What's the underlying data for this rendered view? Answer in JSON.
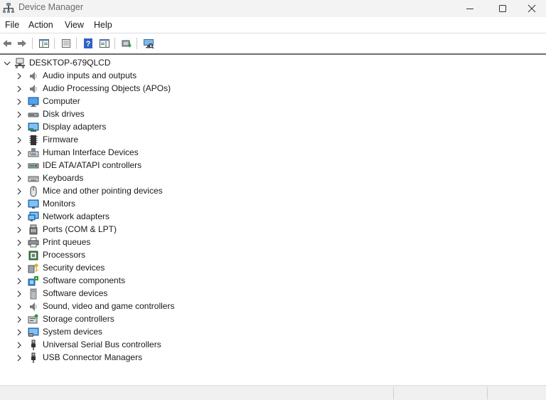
{
  "window": {
    "title": "Device Manager"
  },
  "menu": [
    "File",
    "Action",
    "View",
    "Help"
  ],
  "toolbar": {
    "buttons": [
      "back-icon",
      "forward-icon",
      "show-hide-console-tree-icon",
      "properties-icon",
      "help-icon",
      "action-pane-icon",
      "update-driver-icon",
      "scan-hardware-icon"
    ]
  },
  "tree": {
    "root": "DESKTOP-679QLCD",
    "items": [
      {
        "label": "Audio inputs and outputs",
        "icon": "speaker-icon"
      },
      {
        "label": "Audio Processing Objects (APOs)",
        "icon": "speaker-icon"
      },
      {
        "label": "Computer",
        "icon": "computer-icon"
      },
      {
        "label": "Disk drives",
        "icon": "disk-drive-icon"
      },
      {
        "label": "Display adapters",
        "icon": "display-adapter-icon"
      },
      {
        "label": "Firmware",
        "icon": "firmware-chip-icon"
      },
      {
        "label": "Human Interface Devices",
        "icon": "hid-icon"
      },
      {
        "label": "IDE ATA/ATAPI controllers",
        "icon": "ide-controller-icon"
      },
      {
        "label": "Keyboards",
        "icon": "keyboard-icon"
      },
      {
        "label": "Mice and other pointing devices",
        "icon": "mouse-icon"
      },
      {
        "label": "Monitors",
        "icon": "monitor-icon"
      },
      {
        "label": "Network adapters",
        "icon": "network-adapter-icon"
      },
      {
        "label": "Ports (COM & LPT)",
        "icon": "port-icon"
      },
      {
        "label": "Print queues",
        "icon": "printer-icon"
      },
      {
        "label": "Processors",
        "icon": "processor-icon"
      },
      {
        "label": "Security devices",
        "icon": "security-device-icon"
      },
      {
        "label": "Software components",
        "icon": "software-component-icon"
      },
      {
        "label": "Software devices",
        "icon": "software-device-icon"
      },
      {
        "label": "Sound, video and game controllers",
        "icon": "speaker-icon"
      },
      {
        "label": "Storage controllers",
        "icon": "storage-controller-icon"
      },
      {
        "label": "System devices",
        "icon": "system-device-icon"
      },
      {
        "label": "Universal Serial Bus controllers",
        "icon": "usb-icon"
      },
      {
        "label": "USB Connector Managers",
        "icon": "usb-icon"
      }
    ]
  }
}
